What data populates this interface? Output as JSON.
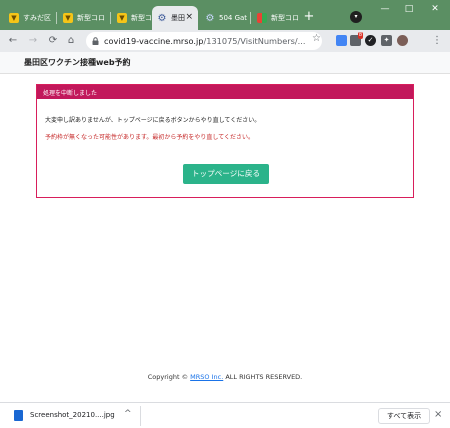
{
  "browser": {
    "tabs": [
      {
        "label": "すみだ区",
        "icon": "yellow-bookmark-icon"
      },
      {
        "label": "新型コロ",
        "icon": "yellow-bookmark-icon"
      },
      {
        "label": "新型コロ",
        "icon": "yellow-bookmark-icon"
      },
      {
        "label": "墨田",
        "icon": "gear-icon",
        "active": true
      },
      {
        "label": "504 Gat",
        "icon": "gear-icon"
      },
      {
        "label": "新型コロ",
        "icon": "multicolor-icon"
      }
    ],
    "tab_close_glyph": "×",
    "new_tab_glyph": "+",
    "tab_search_glyph": "▾",
    "window_controls": {
      "minimize": "—",
      "maximize": "□",
      "close": "✕"
    },
    "url_domain": "covid19-vaccine.mrso.jp",
    "url_path": "/131075/VisitNumbers/...",
    "nav_glyphs": {
      "back": "←",
      "forward": "→",
      "reload": "⟳",
      "home": "⌂"
    },
    "star_glyph": "☆",
    "extension_badge": "8",
    "menu_glyph": "⋮"
  },
  "site": {
    "title": "墨田区ワクチン接種web予約"
  },
  "error_card": {
    "heading": "処理を中断しました",
    "message": "大変申し訳ありませんが、トップページに戻るボタンからやり直してください。",
    "warning": "予約枠が無くなった可能性があります。最初から予約をやり直してください。",
    "button_label": "トップページに戻る"
  },
  "footer": {
    "copyright_prefix": "Copyright © ",
    "company": "MRSO Inc.",
    "copyright_suffix": " ALL RIGHTS RESERVED."
  },
  "download_shelf": {
    "filename": "Screenshot_20210....jpg",
    "chevron": "^",
    "show_all_label": "すべて表示",
    "close_glyph": "×"
  },
  "colors": {
    "tabstrip": "#5b8f63",
    "card_border": "#d81e5b",
    "card_header": "#c2185b",
    "warning_text": "#c62828",
    "primary_button": "#2bb38a",
    "link": "#1a73e8"
  }
}
